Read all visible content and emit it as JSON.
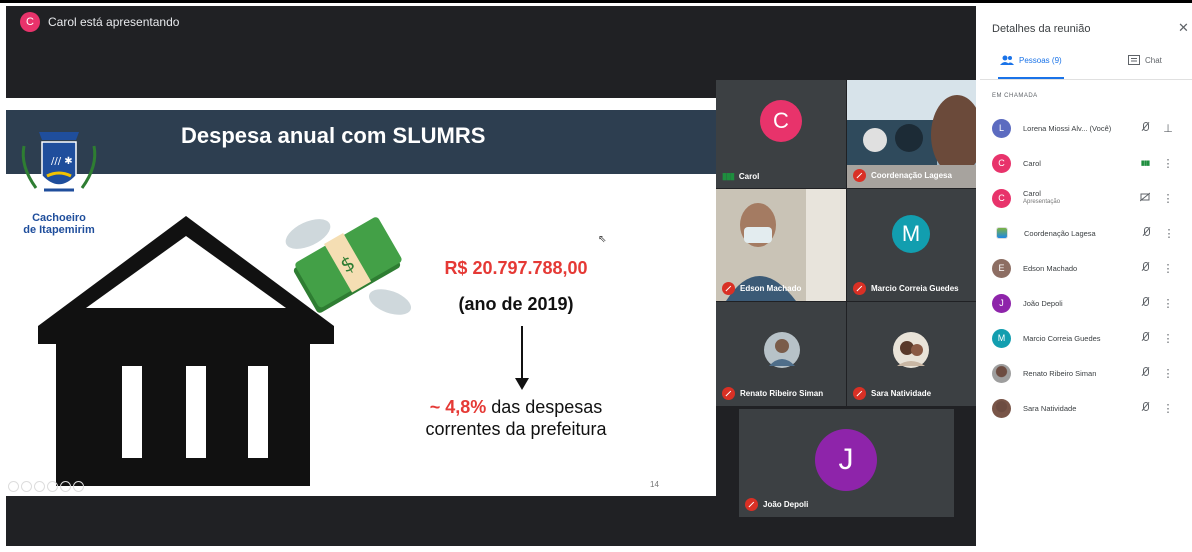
{
  "presenter_banner": {
    "initial": "C",
    "text": "Carol está apresentando",
    "avatar_color": "#e8336b"
  },
  "slide": {
    "title": "Despesa anual com SLUMRS",
    "city_line1": "Cachoeiro",
    "city_line2": "de Itapemirim",
    "amount": "R$ 20.797.788,00",
    "year": "(ano de 2019)",
    "pct_value": "~ 4,8%",
    "pct_rest_line1": " das despesas",
    "pct_line2": "correntes da prefeitura",
    "page_number": "14",
    "band_color": "#2d3e50"
  },
  "tiles": {
    "carol": {
      "initial": "C",
      "label": "Carol",
      "color": "#e8336b"
    },
    "coordenacao": {
      "label": "Coordenação Lagesa"
    },
    "edson": {
      "label": "Edson Machado"
    },
    "marcio": {
      "initial": "M",
      "label": "Marcio Correia Guedes",
      "color": "#129eaf"
    },
    "renato": {
      "label": "Renato Ribeiro Siman"
    },
    "sara": {
      "label": "Sara Natividade"
    },
    "joao": {
      "initial": "J",
      "label": "João Depoli",
      "color": "#8e24aa"
    }
  },
  "panel": {
    "title": "Detalhes da reunião",
    "close_icon": "close-icon",
    "tab_people": "Pessoas (9)",
    "tab_chat": "Chat",
    "section": "EM CHAMADA",
    "people": [
      {
        "initial": "L",
        "name": "Lorena Miossi Alv...  (Você)",
        "sub": "",
        "color": "#5c6bc0",
        "state": "muted"
      },
      {
        "initial": "C",
        "name": "Carol",
        "sub": "",
        "color": "#e8336b",
        "state": "speaking"
      },
      {
        "initial": "C",
        "name": "Carol",
        "sub": "Apresentação",
        "color": "#e8336b",
        "state": "presenting"
      },
      {
        "initial": "",
        "name": "Coordenação Lagesa",
        "sub": "",
        "color": "#ffffff",
        "state": "muted"
      },
      {
        "initial": "E",
        "name": "Edson Machado",
        "sub": "",
        "color": "#8d6e63",
        "state": "muted"
      },
      {
        "initial": "J",
        "name": "João Depoli",
        "sub": "",
        "color": "#8e24aa",
        "state": "muted"
      },
      {
        "initial": "M",
        "name": "Marcio Correia Guedes",
        "sub": "",
        "color": "#129eaf",
        "state": "muted"
      },
      {
        "initial": "",
        "name": "Renato Ribeiro Siman",
        "sub": "",
        "color": "#9e9e9e",
        "state": "muted"
      },
      {
        "initial": "",
        "name": "Sara Natividade",
        "sub": "",
        "color": "#795548",
        "state": "muted"
      }
    ]
  }
}
